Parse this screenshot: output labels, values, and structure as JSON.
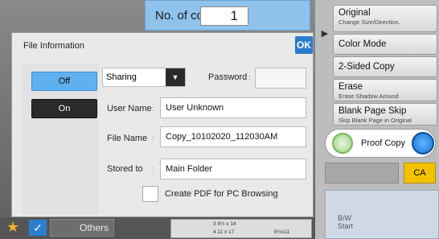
{
  "header": {
    "copies_label": "No. of copies",
    "copies_value": "1"
  },
  "right_panel": {
    "arrow": "▶",
    "buttons": [
      {
        "title": "Original",
        "subtitle": "Change Size/Direction."
      },
      {
        "title": "Color Mode",
        "subtitle": ""
      },
      {
        "title": "2-Sided Copy",
        "subtitle": ""
      },
      {
        "title": "Erase",
        "subtitle": "Erase Shadow Around"
      },
      {
        "title": "Blank Page Skip",
        "subtitle": "Skip Blank Page in Original"
      }
    ],
    "proof_copy": "Proof Copy",
    "ca": "CA",
    "bw_start": "B/W\nStart"
  },
  "bottom_bar": {
    "others": "Others",
    "paper_line1": "3   8½ x 14",
    "paper_line2": "4   11 x 17",
    "paper_line3": "8½x11"
  },
  "dialog": {
    "title": "File Information",
    "ok": "OK",
    "off_label": "Off",
    "on_label": "On",
    "sharing_value": "Sharing",
    "password_label": "Password",
    "password_value": "",
    "user_name_label": "User Name",
    "user_name_value": "User Unknown",
    "file_name_label": "File Name",
    "file_name_value": "Copy_10102020_112030AM",
    "stored_to_label": "Stored to",
    "stored_to_value": "Main Folder",
    "create_pdf_label": "Create PDF for PC Browsing"
  },
  "colors": {
    "accent": "#2a7dcd",
    "selected": "#5fb0ef",
    "ca": "#f2c200"
  }
}
